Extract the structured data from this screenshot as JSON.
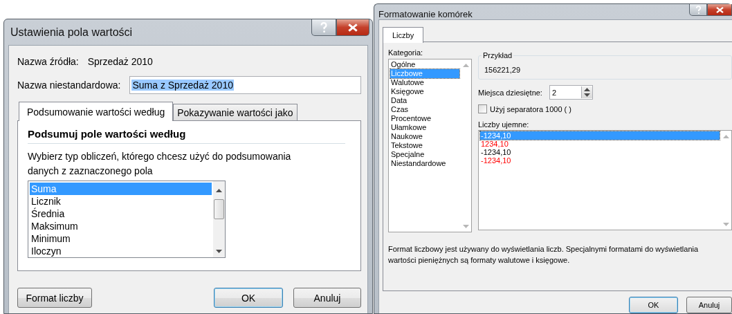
{
  "field_settings": {
    "title": "Ustawienia pola wartości",
    "source_label": "Nazwa źródła:",
    "source_value": "Sprzedaż 2010",
    "custom_name_label": "Nazwa niestandardowa:",
    "custom_name_value": "Suma z Sprzedaż 2010",
    "tabs": [
      {
        "label": "Podsumowanie wartości według",
        "selected": true
      },
      {
        "label": "Pokazywanie wartości jako",
        "selected": false
      }
    ],
    "heading": "Podsumuj pole wartości według",
    "description": "Wybierz typ obliczeń, którego chcesz użyć do podsumowania danych z zaznaczonego pola",
    "functions": [
      {
        "label": "Suma",
        "selected": true
      },
      {
        "label": "Licznik",
        "selected": false
      },
      {
        "label": "Średnia",
        "selected": false
      },
      {
        "label": "Maksimum",
        "selected": false
      },
      {
        "label": "Minimum",
        "selected": false
      },
      {
        "label": "Iloczyn",
        "selected": false
      }
    ],
    "buttons": [
      {
        "label": "Format liczby",
        "kind": "secondary"
      },
      {
        "label": "OK",
        "kind": "default"
      },
      {
        "label": "Anuluj",
        "kind": "secondary"
      }
    ]
  },
  "format_cells": {
    "title": "Formatowanie komórek",
    "tabs": [
      {
        "label": "Liczby",
        "selected": true
      }
    ],
    "category_label": "Kategoria:",
    "categories": [
      {
        "label": "Ogólne",
        "selected": false
      },
      {
        "label": "Liczbowe",
        "selected": true
      },
      {
        "label": "Walutowe",
        "selected": false
      },
      {
        "label": "Księgowe",
        "selected": false
      },
      {
        "label": "Data",
        "selected": false
      },
      {
        "label": "Czas",
        "selected": false
      },
      {
        "label": "Procentowe",
        "selected": false
      },
      {
        "label": "Ułamkowe",
        "selected": false
      },
      {
        "label": "Naukowe",
        "selected": false
      },
      {
        "label": "Tekstowe",
        "selected": false
      },
      {
        "label": "Specjalne",
        "selected": false
      },
      {
        "label": "Niestandardowe",
        "selected": false
      }
    ],
    "sample_label": "Przykład",
    "sample_value": "156221,29",
    "decimals_label": "Miejsca dziesiętne:",
    "decimals_value": "2",
    "separator": {
      "label": "Użyj separatora 1000 ( )",
      "checked": false
    },
    "negative_label": "Liczby ujemne:",
    "negative_formats": [
      {
        "label": "-1234,10",
        "red": false,
        "selected": true
      },
      {
        "label": "1234,10",
        "red": true,
        "selected": false
      },
      {
        "label": "-1234,10",
        "red": false,
        "selected": false
      },
      {
        "label": "-1234,10",
        "red": true,
        "selected": false
      }
    ],
    "description": "Format liczbowy jest używany do wyświetlania liczb. Specjalnymi formatami do wyświetlania wartości pieniężnych są formaty walutowe i księgowe.",
    "buttons": [
      {
        "label": "OK",
        "kind": "default"
      },
      {
        "label": "Anuluj",
        "kind": "secondary"
      }
    ]
  }
}
